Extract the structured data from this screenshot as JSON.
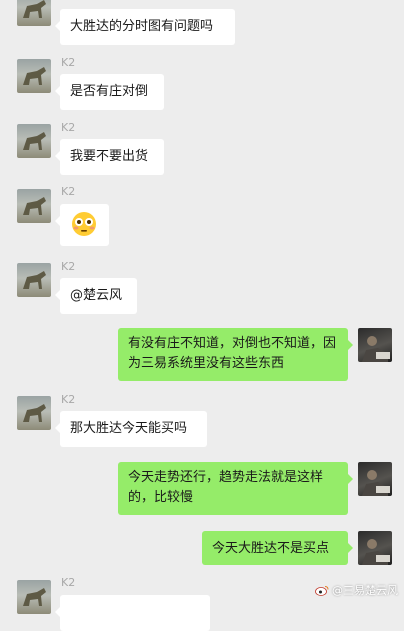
{
  "chat": {
    "messages": [
      {
        "sender": "K2",
        "side": "left",
        "text": "大胜达的分时图有问题吗",
        "show_name": false
      },
      {
        "sender": "K2",
        "side": "left",
        "text": "是否有庄对倒",
        "show_name": true
      },
      {
        "sender": "K2",
        "side": "left",
        "text": "我要不要出货",
        "show_name": true
      },
      {
        "sender": "K2",
        "side": "left",
        "text": "",
        "emoji": "😳",
        "show_name": true
      },
      {
        "sender": "K2",
        "side": "left",
        "text": "@楚云风",
        "show_name": true
      },
      {
        "sender": "me",
        "side": "right",
        "text": "有没有庄不知道，对倒也不知道，因为三易系统里没有这些东西"
      },
      {
        "sender": "K2",
        "side": "left",
        "text": "那大胜达今天能买吗",
        "show_name": true
      },
      {
        "sender": "me",
        "side": "right",
        "text": "今天走势还行，趋势走法就是这样的，比较慢"
      },
      {
        "sender": "me",
        "side": "right",
        "text": "今天大胜达不是买点"
      },
      {
        "sender": "K2",
        "side": "left",
        "text": "",
        "show_name": true
      }
    ]
  },
  "watermark": {
    "text": "@三易楚云风"
  },
  "colors": {
    "background": "#ededed",
    "incoming_bubble": "#ffffff",
    "outgoing_bubble": "#95ec69",
    "name": "#a8a8a8"
  }
}
